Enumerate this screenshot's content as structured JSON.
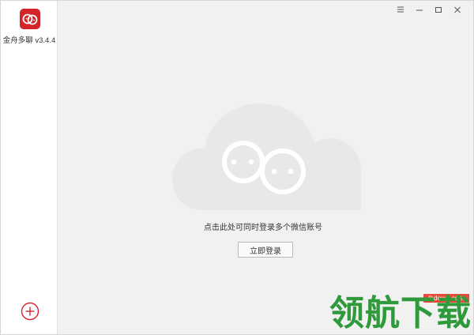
{
  "app": {
    "name": "金舟多聊 v3.4.4",
    "logo_icon": "chat-bubbles-logo",
    "brand_color": "#d3242c"
  },
  "window_controls": {
    "menu_icon": "menu-icon",
    "minimize_icon": "minimize-icon",
    "maximize_icon": "maximize-icon",
    "close_icon": "close-icon"
  },
  "sidebar": {
    "add_icon": "add-account-icon",
    "add_color": "#d3242c"
  },
  "main": {
    "illustration_icon": "cloud-chat-icon",
    "prompt": "点击此处可同时登录多个微信账号",
    "login_button": "立即登录"
  },
  "watermark": {
    "url": "lhdown.com",
    "title": "领航下载",
    "title_color": "#2f9a3c",
    "url_bg": "#e84b3a"
  }
}
